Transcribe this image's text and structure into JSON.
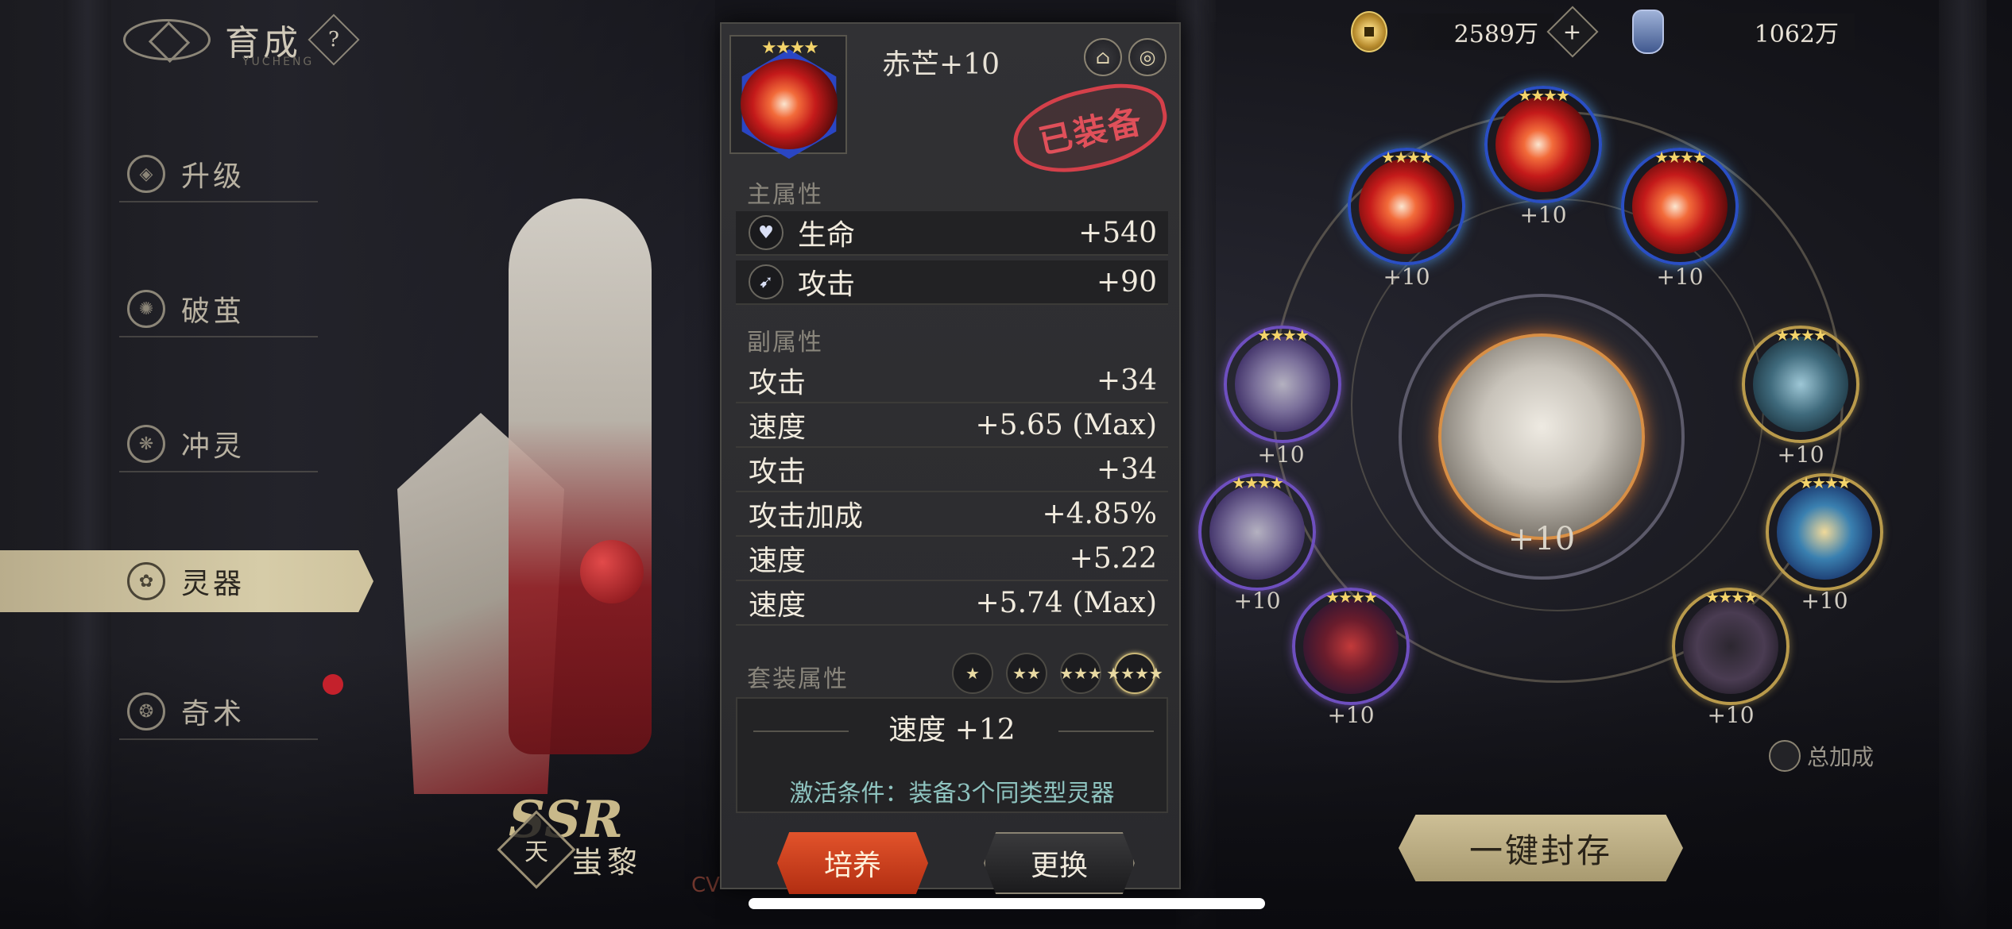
{
  "nav": {
    "title": "育成",
    "subtitle": "YUCHENG",
    "help": "?",
    "items": [
      {
        "label": "升级",
        "icon": "upgrade-icon",
        "active": false
      },
      {
        "label": "破茧",
        "icon": "breakthrough-icon",
        "active": false
      },
      {
        "label": "冲灵",
        "icon": "spirit-rush-icon",
        "active": false
      },
      {
        "label": "灵器",
        "icon": "artifact-icon",
        "active": true
      },
      {
        "label": "奇术",
        "icon": "arcane-icon",
        "active": false
      }
    ]
  },
  "character": {
    "rarity": "SSR",
    "tier": "天",
    "name": "蚩黎",
    "cv": "CV"
  },
  "currency": {
    "coins": "2589万",
    "coins_add": "+",
    "potion": "1062万"
  },
  "detail": {
    "item_name": "赤芒+10",
    "stars": "★★★★",
    "lock_icon": "lock-icon",
    "spirit_icon": "spirit-icon",
    "equipped_stamp": "已装备",
    "main_section": "主属性",
    "main_stats": [
      {
        "name": "生命",
        "value": "+540",
        "icon": "hp-icon"
      },
      {
        "name": "攻击",
        "value": "+90",
        "icon": "attack-icon"
      }
    ],
    "sub_section": "副属性",
    "sub_stats": [
      {
        "name": "攻击",
        "value": "+34"
      },
      {
        "name": "速度",
        "value": "+5.65 (Max)"
      },
      {
        "name": "攻击",
        "value": "+34"
      },
      {
        "name": "攻击加成",
        "value": "+4.85%"
      },
      {
        "name": "速度",
        "value": "+5.22"
      },
      {
        "name": "速度",
        "value": "+5.74 (Max)"
      }
    ],
    "set_section": "套装属性",
    "set_stars": [
      "★",
      "★★",
      "★★★",
      "★★★★"
    ],
    "set_effect": "速度 +12",
    "set_condition": "激活条件：装备3个同类型灵器",
    "btn_cultivate": "培养",
    "btn_replace": "更换"
  },
  "wheel": {
    "center_level": "+10",
    "slots": [
      {
        "name": "slot-top",
        "level": "+10",
        "stars": "★★★★"
      },
      {
        "name": "slot-top-left",
        "level": "+10",
        "stars": "★★★★"
      },
      {
        "name": "slot-top-right",
        "level": "+10",
        "stars": "★★★★"
      },
      {
        "name": "slot-left-upper",
        "level": "+10",
        "stars": "★★★★"
      },
      {
        "name": "slot-right-upper",
        "level": "+10",
        "stars": "★★★★"
      },
      {
        "name": "slot-left-lower",
        "level": "+10",
        "stars": "★★★★"
      },
      {
        "name": "slot-right-lower",
        "level": "+10",
        "stars": "★★★★"
      },
      {
        "name": "slot-bottom-left",
        "level": "+10",
        "stars": "★★★★"
      },
      {
        "name": "slot-bottom-right",
        "level": "+10",
        "stars": "★★★★"
      }
    ],
    "total_bonus": "总加成",
    "seal_button": "一键封存"
  }
}
